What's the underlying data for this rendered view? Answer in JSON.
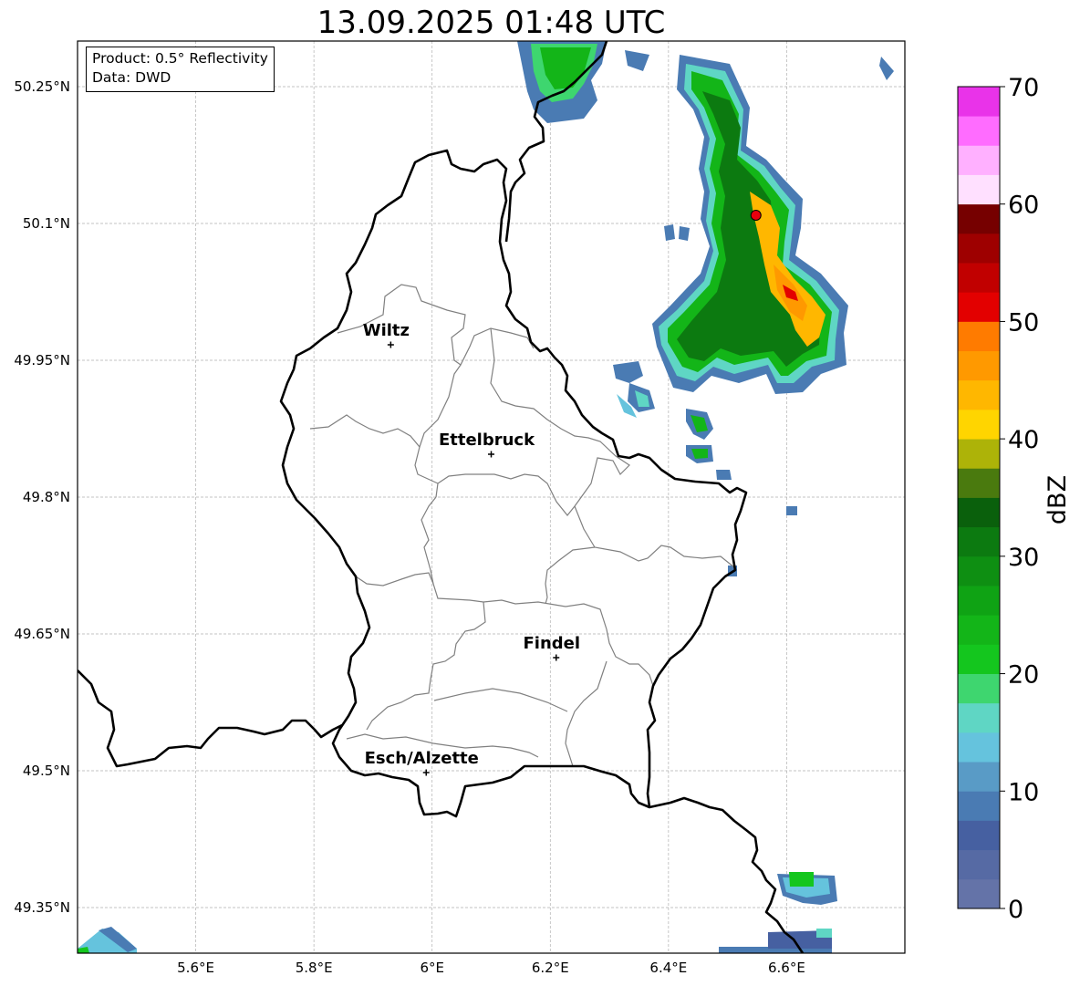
{
  "title": "13.09.2025 01:48 UTC",
  "info_box": {
    "product": "Product: 0.5° Reflectivity",
    "data": "Data: DWD"
  },
  "axes": {
    "lon_ticks": [
      {
        "value": 5.6,
        "label": "5.6°E"
      },
      {
        "value": 5.8,
        "label": "5.8°E"
      },
      {
        "value": 6.0,
        "label": "6°E"
      },
      {
        "value": 6.2,
        "label": "6.2°E"
      },
      {
        "value": 6.4,
        "label": "6.4°E"
      },
      {
        "value": 6.6,
        "label": "6.6°E"
      }
    ],
    "lat_ticks": [
      {
        "value": 50.25,
        "label": "50.25°N"
      },
      {
        "value": 50.1,
        "label": "50.1°N"
      },
      {
        "value": 49.95,
        "label": "49.95°N"
      },
      {
        "value": 49.8,
        "label": "49.8°N"
      },
      {
        "value": 49.65,
        "label": "49.65°N"
      },
      {
        "value": 49.5,
        "label": "49.5°N"
      },
      {
        "value": 49.35,
        "label": "49.35°N"
      }
    ],
    "lon_range": [
      5.4,
      6.8
    ],
    "lat_range": [
      49.3,
      50.3
    ],
    "grid": true
  },
  "cities": [
    {
      "name": "Wiltz",
      "lon": 5.93,
      "lat": 49.967
    },
    {
      "name": "Ettelbruck",
      "lon": 6.1,
      "lat": 49.847
    },
    {
      "name": "Findel",
      "lon": 6.21,
      "lat": 49.624
    },
    {
      "name": "Esch/Alzette",
      "lon": 5.99,
      "lat": 49.498
    }
  ],
  "radar_site": {
    "lon": 6.548,
    "lat": 50.109,
    "color": "#e8000d"
  },
  "colorbar": {
    "label": "dBZ",
    "min": 0,
    "max": 70,
    "step": 2.5,
    "tick_labels": [
      "0",
      "10",
      "20",
      "30",
      "40",
      "50",
      "60",
      "70"
    ],
    "colors": [
      "#6473a8",
      "#566aa4",
      "#4660a1",
      "#4a7bb3",
      "#599bc6",
      "#65c3dd",
      "#5fd6c4",
      "#3ed66f",
      "#14c61e",
      "#13b518",
      "#0fa314",
      "#0e8f12",
      "#0c7a10",
      "#0a600c",
      "#4a7a0e",
      "#adb308",
      "#ffd500",
      "#ffb700",
      "#ff9900",
      "#ff7b00",
      "#e30000",
      "#c10000",
      "#9e0000",
      "#760000",
      "#ffe0ff",
      "#ffb0ff",
      "#ff6cff",
      "#e933e9"
    ]
  },
  "colors": {
    "border_country": "#000000",
    "border_canton": "#808080",
    "grid": "#b0b0b0"
  }
}
